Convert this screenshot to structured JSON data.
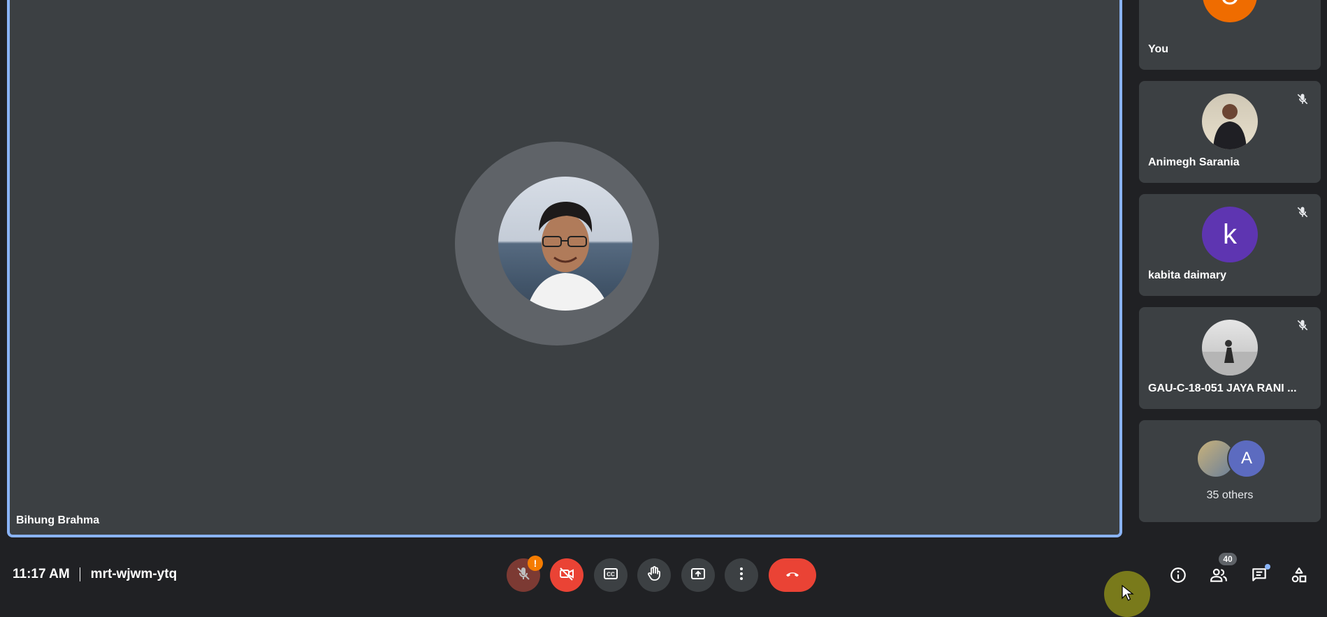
{
  "main_stage": {
    "speaker_name": "Bihung Brahma"
  },
  "participants": [
    {
      "name": "You",
      "avatar_letter": "U",
      "avatar_color": "#ef6c00",
      "muted": false
    },
    {
      "name": "Animegh Sarania",
      "avatar_letter": "",
      "muted": true
    },
    {
      "name": "kabita daimary",
      "avatar_letter": "k",
      "avatar_color": "#5e35b1",
      "muted": true
    },
    {
      "name": "GAU-C-18-051 JAYA RANI ...",
      "avatar_letter": "",
      "muted": true
    }
  ],
  "others_tile": {
    "label": "35 others",
    "avatar_letter": "A",
    "avatar_color": "#5c6bc0"
  },
  "footer": {
    "time": "11:17 AM",
    "meeting_code": "mrt-wjwm-ytq",
    "mic_alert": "!",
    "people_count": "40"
  },
  "colors": {
    "accent_border": "#8ab4f8",
    "end_call": "#ea4335",
    "camera_off": "#ea4335",
    "tile_bg": "#3c4043",
    "page_bg": "#202124"
  },
  "icons": {
    "mic": "mic-off-icon",
    "camera": "videocam-off-icon",
    "captions": "closed-caption-icon",
    "hand": "raise-hand-icon",
    "present": "present-screen-icon",
    "more": "more-vert-icon",
    "end": "call-end-icon",
    "info": "info-icon",
    "people": "people-icon",
    "chat": "chat-icon",
    "activities": "activities-icon"
  }
}
